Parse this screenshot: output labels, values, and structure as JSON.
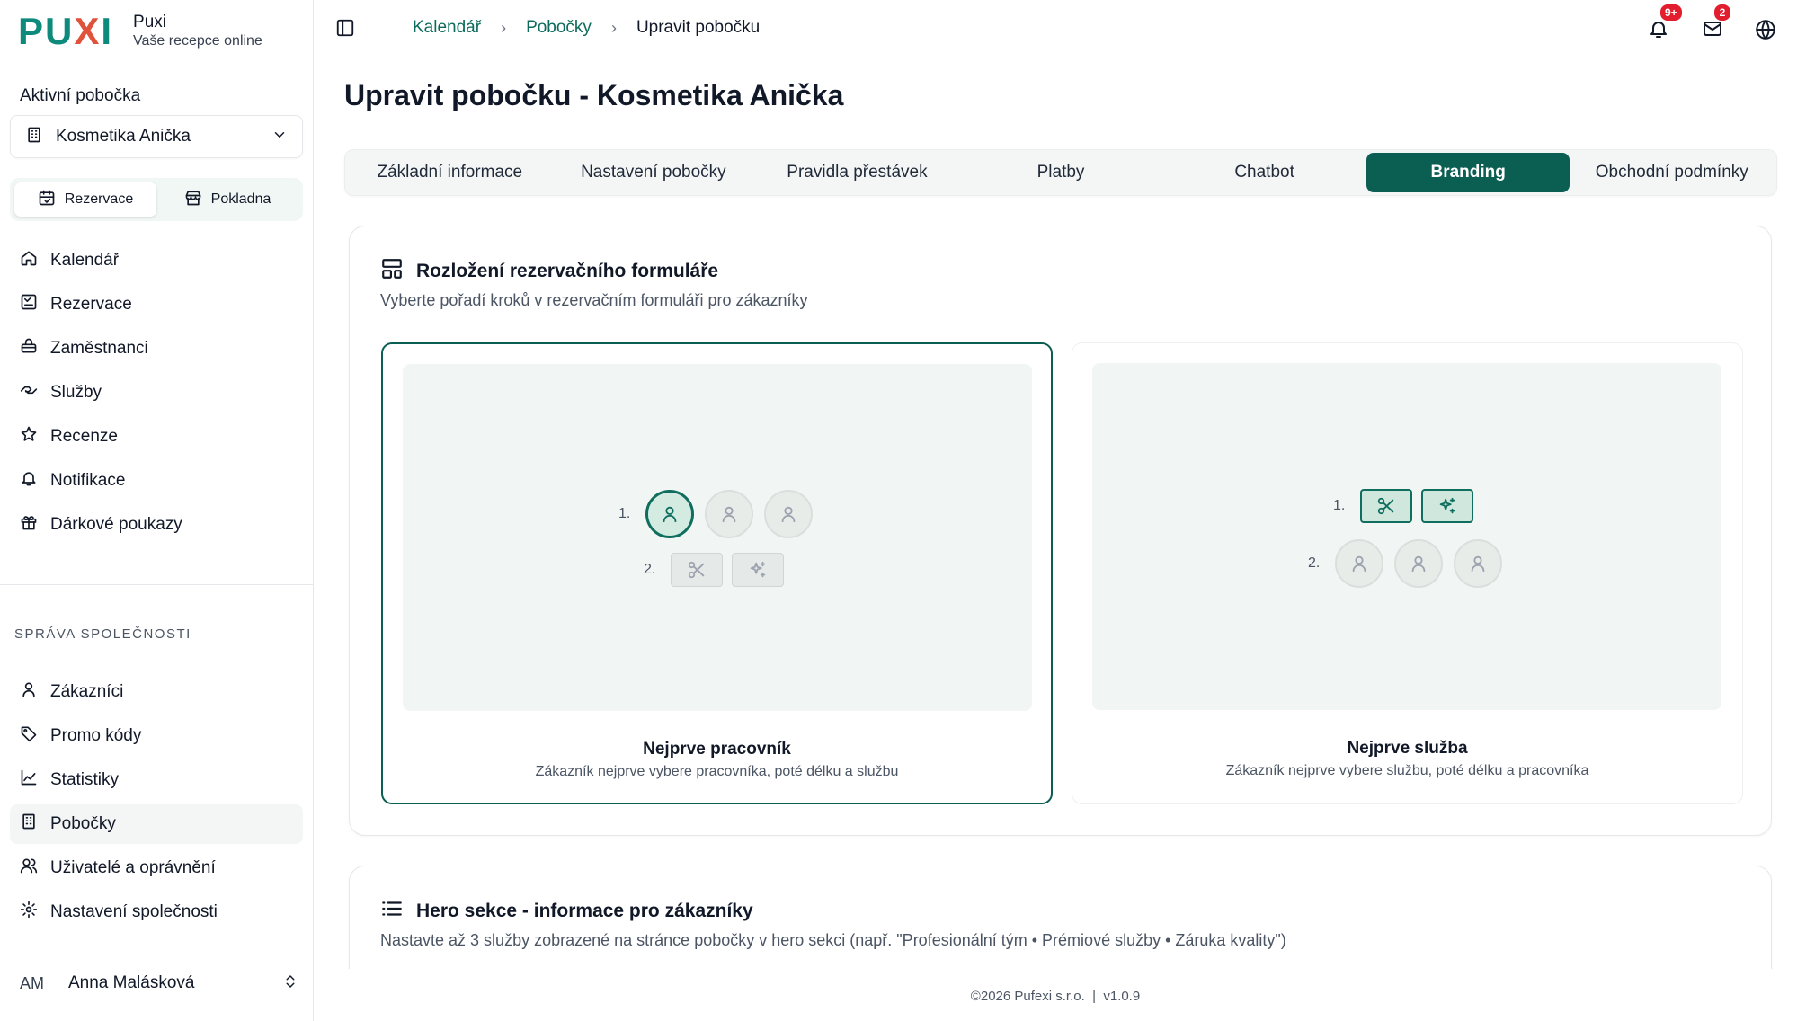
{
  "brand": {
    "logo_p": "PU",
    "logo_x": "X",
    "logo_i": "I",
    "name": "Puxi",
    "tagline": "Vaše recepce online"
  },
  "sidebar": {
    "active_branch_label": "Aktivní pobočka",
    "branch_name": "Kosmetika Anička",
    "segments": [
      {
        "label": "Rezervace",
        "icon": "calendar-icon",
        "active": true
      },
      {
        "label": "Pokladna",
        "icon": "store-icon",
        "active": false
      }
    ],
    "main_items": [
      {
        "label": "Kalendář",
        "icon": "home-icon"
      },
      {
        "label": "Rezervace",
        "icon": "reservation-icon"
      },
      {
        "label": "Zaměstnanci",
        "icon": "employees-icon"
      },
      {
        "label": "Služby",
        "icon": "handshake-icon"
      },
      {
        "label": "Recenze",
        "icon": "star-icon"
      },
      {
        "label": "Notifikace",
        "icon": "bell-icon"
      },
      {
        "label": "Dárkové poukazy",
        "icon": "gift-icon"
      }
    ],
    "company_section_label": "SPRÁVA SPOLEČNOSTI",
    "company_items": [
      {
        "label": "Zákazníci",
        "icon": "user-icon"
      },
      {
        "label": "Promo kódy",
        "icon": "tag-icon"
      },
      {
        "label": "Statistiky",
        "icon": "chart-icon"
      },
      {
        "label": "Pobočky",
        "icon": "building-icon",
        "active": true
      },
      {
        "label": "Uživatelé a oprávnění",
        "icon": "users-icon"
      },
      {
        "label": "Nastavení společnosti",
        "icon": "gear-icon"
      }
    ],
    "user": {
      "initials": "AM",
      "name": "Anna Malásková"
    }
  },
  "header": {
    "breadcrumbs": [
      "Kalendář",
      "Pobočky"
    ],
    "breadcrumb_current": "Upravit pobočku",
    "notifications_badge": "9+",
    "messages_badge": "2"
  },
  "page": {
    "title": "Upravit pobočku - Kosmetika Anička",
    "tabs": [
      {
        "label": "Základní informace",
        "active": false
      },
      {
        "label": "Nastavení pobočky",
        "active": false
      },
      {
        "label": "Pravidla přestávek",
        "active": false
      },
      {
        "label": "Platby",
        "active": false
      },
      {
        "label": "Chatbot",
        "active": false
      },
      {
        "label": "Branding",
        "active": true
      },
      {
        "label": "Obchodní podmínky",
        "active": false
      }
    ]
  },
  "layout_card": {
    "title": "Rozložení rezervačního formuláře",
    "description": "Vyberte pořadí kroků v rezervačním formuláři pro zákazníky",
    "options": [
      {
        "title": "Nejprve pracovník",
        "description": "Zákazník nejprve vybere pracovníka, poté délku a službu",
        "selected": true,
        "step1": "1.",
        "step2": "2."
      },
      {
        "title": "Nejprve služba",
        "description": "Zákazník nejprve vybere službu, poté délku a pracovníka",
        "selected": false,
        "step1": "1.",
        "step2": "2."
      }
    ]
  },
  "hero_card": {
    "title": "Hero sekce - informace pro zákazníky",
    "description": "Nastavte až 3 služby zobrazené na stránce pobočky v hero sekci (např. \"Profesionální tým • Prémiové služby • Záruka kvality\")"
  },
  "footer": {
    "text": "©2026 Pufexi s.r.o.  |  v1.0.9"
  },
  "colors": {
    "accent": "#0b5e52",
    "link": "#0e6b5c",
    "badge": "#e11d2e",
    "logo_x": "#e0533a"
  }
}
